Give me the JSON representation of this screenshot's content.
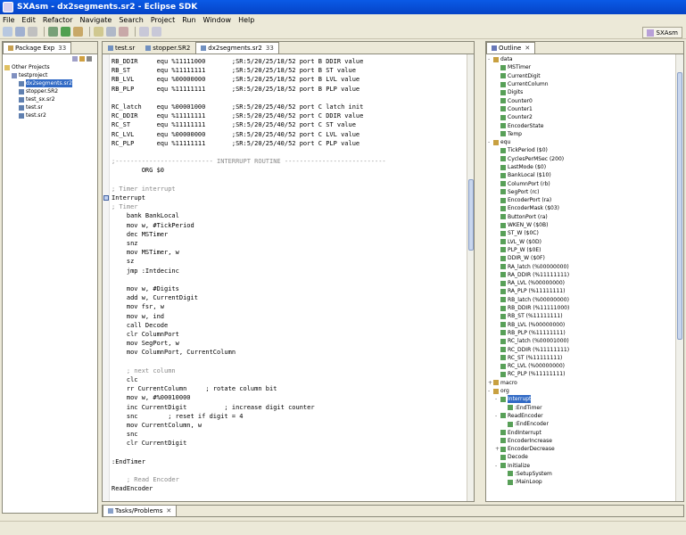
{
  "window": {
    "title": "SXAsm - dx2segments.sr2 - Eclipse SDK"
  },
  "menu": [
    "File",
    "Edit",
    "Refactor",
    "Navigate",
    "Search",
    "Project",
    "Run",
    "Window",
    "Help"
  ],
  "perspective_label": "SXAsm",
  "package_explorer": {
    "tab": "Package Exp",
    "tab_count": "33",
    "tree": [
      {
        "label": "Other Projects",
        "depth": 0,
        "icon": "folder-icon"
      },
      {
        "label": "testproject",
        "depth": 1,
        "icon": "project-icon"
      },
      {
        "label": "dx2segments.sr2",
        "depth": 2,
        "icon": "file-icon",
        "selected": true
      },
      {
        "label": "stopper.SR2",
        "depth": 2,
        "icon": "file-icon"
      },
      {
        "label": "test_sx.sr2",
        "depth": 2,
        "icon": "file-icon"
      },
      {
        "label": "test.sr",
        "depth": 2,
        "icon": "file-icon"
      },
      {
        "label": "test.sr2",
        "depth": 2,
        "icon": "file-icon"
      }
    ]
  },
  "editor": {
    "tabs": [
      {
        "label": "test.sr",
        "active": false
      },
      {
        "label": "stopper.SR2",
        "active": false
      },
      {
        "label": "dx2segments.sr2",
        "active": true,
        "count": "33"
      }
    ],
    "lines": [
      {
        "t": "RB_DDIR     equ %11111000       ;SR:5/20/25/18/52 port B DDIR value",
        "c": false
      },
      {
        "t": "RB_ST       equ %11111111       ;SR:5/20/25/18/52 port B ST value",
        "c": false
      },
      {
        "t": "RB_LVL      equ %00000000       ;SR:5/20/25/18/52 port B LVL value",
        "c": false
      },
      {
        "t": "RB_PLP      equ %11111111       ;SR:5/20/25/18/52 port B PLP value",
        "c": false
      },
      {
        "t": "",
        "c": false
      },
      {
        "t": "RC_latch    equ %00001000       ;SR:5/20/25/40/52 port C latch init",
        "c": false
      },
      {
        "t": "RC_DDIR     equ %11111111       ;SR:5/20/25/40/52 port C DDIR value",
        "c": false
      },
      {
        "t": "RC_ST       equ %11111111       ;SR:5/20/25/40/52 port C ST value",
        "c": false
      },
      {
        "t": "RC_LVL      equ %00000000       ;SR:5/20/25/40/52 port C LVL value",
        "c": false
      },
      {
        "t": "RC_PLP      equ %11111111       ;SR:5/20/25/40/52 port C PLP value",
        "c": false
      },
      {
        "t": "",
        "c": false
      },
      {
        "t": ";-------------------------- INTERRUPT ROUTINE ---------------------------",
        "c": true
      },
      {
        "t": "        ORG $0",
        "c": false
      },
      {
        "t": "",
        "c": false
      },
      {
        "t": "; Timer interrupt",
        "c": true
      },
      {
        "t": "Interrupt",
        "c": false,
        "mark": true
      },
      {
        "t": "; Timer",
        "c": true
      },
      {
        "t": "    bank BankLocal",
        "c": false
      },
      {
        "t": "    mov w, #TickPeriod",
        "c": false
      },
      {
        "t": "    dec MSTimer",
        "c": false
      },
      {
        "t": "    snz",
        "c": false
      },
      {
        "t": "    mov MSTimer, w",
        "c": false
      },
      {
        "t": "    sz",
        "c": false
      },
      {
        "t": "    jmp :Intdecinc",
        "c": false
      },
      {
        "t": "",
        "c": false
      },
      {
        "t": "    mov w, #Digits",
        "c": false
      },
      {
        "t": "    add w, CurrentDigit",
        "c": false
      },
      {
        "t": "    mov fsr, w",
        "c": false
      },
      {
        "t": "    mov w, ind",
        "c": false
      },
      {
        "t": "    call Decode",
        "c": false
      },
      {
        "t": "    clr ColumnPort",
        "c": false
      },
      {
        "t": "    mov SegPort, w",
        "c": false
      },
      {
        "t": "    mov ColumnPort, CurrentColumn",
        "c": false
      },
      {
        "t": "",
        "c": false
      },
      {
        "t": "    ; next column",
        "c": true
      },
      {
        "t": "    clc",
        "c": false
      },
      {
        "t": "    rr CurrentColumn     ; rotate column bit",
        "c": false
      },
      {
        "t": "    mov w, #%00010000",
        "c": false
      },
      {
        "t": "    inc CurrentDigit          ; increase digit counter",
        "c": false
      },
      {
        "t": "    snc        ; reset if digit = 4",
        "c": false
      },
      {
        "t": "    mov CurrentColumn, w",
        "c": false
      },
      {
        "t": "    snc",
        "c": false
      },
      {
        "t": "    clr CurrentDigit",
        "c": false
      },
      {
        "t": "",
        "c": false
      },
      {
        "t": ":EndTimer",
        "c": false
      },
      {
        "t": "",
        "c": false
      },
      {
        "t": "    ; Read Encoder",
        "c": true
      },
      {
        "t": "ReadEncoder",
        "c": false
      }
    ]
  },
  "outline": {
    "tab": "Outline",
    "tree": [
      {
        "label": "data",
        "depth": 0,
        "exp": "-"
      },
      {
        "label": "MSTimer",
        "depth": 1
      },
      {
        "label": "CurrentDigit",
        "depth": 1
      },
      {
        "label": "CurrentColumn",
        "depth": 1
      },
      {
        "label": "Digits",
        "depth": 1
      },
      {
        "label": "Counter0",
        "depth": 1
      },
      {
        "label": "Counter1",
        "depth": 1
      },
      {
        "label": "Counter2",
        "depth": 1
      },
      {
        "label": "EncoderState",
        "depth": 1
      },
      {
        "label": "Temp",
        "depth": 1
      },
      {
        "label": "equ",
        "depth": 0,
        "exp": "-"
      },
      {
        "label": "TickPeriod ($0)",
        "depth": 1
      },
      {
        "label": "CyclesPerMSec (200)",
        "depth": 1
      },
      {
        "label": "LastMode ($0)",
        "depth": 1
      },
      {
        "label": "BankLocal ($10)",
        "depth": 1
      },
      {
        "label": "ColumnPort (rb)",
        "depth": 1
      },
      {
        "label": "SegPort (rc)",
        "depth": 1
      },
      {
        "label": "EncoderPort (ra)",
        "depth": 1
      },
      {
        "label": "EncoderMask ($03)",
        "depth": 1
      },
      {
        "label": "ButtonPort (ra)",
        "depth": 1
      },
      {
        "label": "WKEN_W ($0B)",
        "depth": 1
      },
      {
        "label": "ST_W ($0C)",
        "depth": 1
      },
      {
        "label": "LVL_W ($0D)",
        "depth": 1
      },
      {
        "label": "PLP_W ($0E)",
        "depth": 1
      },
      {
        "label": "DDIR_W ($0F)",
        "depth": 1
      },
      {
        "label": "RA_latch (%00000000)",
        "depth": 1
      },
      {
        "label": "RA_DDIR (%11111111)",
        "depth": 1
      },
      {
        "label": "RA_LVL (%00000000)",
        "depth": 1
      },
      {
        "label": "RA_PLP (%11111111)",
        "depth": 1
      },
      {
        "label": "RB_latch (%00000000)",
        "depth": 1
      },
      {
        "label": "RB_DDIR (%11111000)",
        "depth": 1
      },
      {
        "label": "RB_ST (%11111111)",
        "depth": 1
      },
      {
        "label": "RB_LVL (%00000000)",
        "depth": 1
      },
      {
        "label": "RB_PLP (%11111111)",
        "depth": 1
      },
      {
        "label": "RC_latch (%00001000)",
        "depth": 1
      },
      {
        "label": "RC_DDIR (%11111111)",
        "depth": 1
      },
      {
        "label": "RC_ST (%11111111)",
        "depth": 1
      },
      {
        "label": "RC_LVL (%00000000)",
        "depth": 1
      },
      {
        "label": "RC_PLP (%11111111)",
        "depth": 1
      },
      {
        "label": "macro",
        "depth": 0,
        "exp": "+"
      },
      {
        "label": "org",
        "depth": 0,
        "exp": "-"
      },
      {
        "label": "Interrupt",
        "depth": 1,
        "selected": true,
        "exp": "-"
      },
      {
        "label": ":EndTimer",
        "depth": 2
      },
      {
        "label": "ReadEncoder",
        "depth": 1,
        "exp": "-"
      },
      {
        "label": ":EndEncoder",
        "depth": 2
      },
      {
        "label": "EndInterrupt",
        "depth": 1
      },
      {
        "label": "EncoderIncrease",
        "depth": 1
      },
      {
        "label": "EncoderDecrease",
        "depth": 1,
        "exp": "+"
      },
      {
        "label": "Decode",
        "depth": 1
      },
      {
        "label": "Initialize",
        "depth": 1,
        "exp": "-"
      },
      {
        "label": ":SetupSystem",
        "depth": 2
      },
      {
        "label": ":MainLoop",
        "depth": 2
      }
    ]
  },
  "console": {
    "tab": "Tasks/Problems"
  }
}
